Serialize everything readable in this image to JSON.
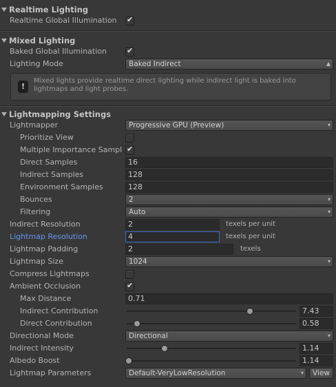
{
  "sections": {
    "realtime": {
      "title": "Realtime Lighting"
    },
    "mixed": {
      "title": "Mixed Lighting"
    },
    "lightmapping": {
      "title": "Lightmapping Settings"
    }
  },
  "realtime": {
    "gi_label": "Realtime Global Illumination",
    "gi_checked": true
  },
  "mixed": {
    "baked_gi_label": "Baked Global Illumination",
    "baked_gi_checked": true,
    "lighting_mode_label": "Lighting Mode",
    "lighting_mode_value": "Baked Indirect",
    "info_text": "Mixed lights provide realtime direct lighting while indirect light is baked into lightmaps and light probes."
  },
  "lm": {
    "lightmapper_label": "Lightmapper",
    "lightmapper_value": "Progressive GPU (Preview)",
    "prioritize_view_label": "Prioritize View",
    "prioritize_view_checked": false,
    "multiple_importance_label": "Multiple Importance Sampl",
    "multiple_importance_checked": true,
    "direct_samples_label": "Direct Samples",
    "direct_samples_value": "16",
    "indirect_samples_label": "Indirect Samples",
    "indirect_samples_value": "128",
    "environment_samples_label": "Environment Samples",
    "environment_samples_value": "128",
    "bounces_label": "Bounces",
    "bounces_value": "2",
    "filtering_label": "Filtering",
    "filtering_value": "Auto",
    "indirect_resolution_label": "Indirect Resolution",
    "indirect_resolution_value": "2",
    "indirect_resolution_unit": "texels per unit",
    "lightmap_resolution_label": "Lightmap Resolution",
    "lightmap_resolution_value": "4",
    "lightmap_resolution_unit": "texels per unit",
    "lightmap_padding_label": "Lightmap Padding",
    "lightmap_padding_value": "2",
    "lightmap_padding_unit": "texels",
    "lightmap_size_label": "Lightmap Size",
    "lightmap_size_value": "1024",
    "compress_label": "Compress Lightmaps",
    "compress_checked": false,
    "ao_label": "Ambient Occlusion",
    "ao_checked": true,
    "max_distance_label": "Max Distance",
    "max_distance_value": "0.71",
    "indirect_contribution_label": "Indirect Contribution",
    "indirect_contribution_value": "7.43",
    "direct_contribution_label": "Direct Contribution",
    "direct_contribution_value": "0.58",
    "directional_mode_label": "Directional Mode",
    "directional_mode_value": "Directional",
    "indirect_intensity_label": "Indirect Intensity",
    "indirect_intensity_value": "1.14",
    "albedo_boost_label": "Albedo Boost",
    "albedo_boost_value": "1.14",
    "lightmap_params_label": "Lightmap Parameters",
    "lightmap_params_value": "Default-VeryLowResolution",
    "view_button_label": "View"
  },
  "icons": {
    "dropdown": "↕",
    "info": "!"
  },
  "colors": {
    "background": "#383838",
    "highlight_label": "#6495ee",
    "focus_border": "#3c6ac8"
  }
}
